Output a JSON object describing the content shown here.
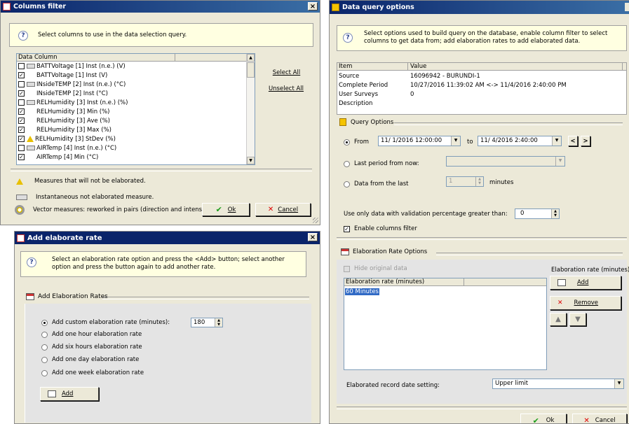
{
  "columns_filter": {
    "title": "Columns filter",
    "close": "×",
    "info": "Select columns to use in the data selection query.",
    "list_header": "Data Column",
    "rows": [
      {
        "checked": false,
        "icon": "instant",
        "text": "BATTVoltage [1] Inst (n.e.) (V)"
      },
      {
        "checked": true,
        "icon": "",
        "text": "BATTVoltage [1] Inst (V)"
      },
      {
        "checked": false,
        "icon": "instant",
        "text": "INsideTEMP [2] Inst (n.e.) (°C)"
      },
      {
        "checked": true,
        "icon": "",
        "text": "INsideTEMP [2] Inst (°C)"
      },
      {
        "checked": false,
        "icon": "instant",
        "text": "RELHumidity [3] Inst (n.e.) (%)"
      },
      {
        "checked": true,
        "icon": "",
        "text": "RELHumidity [3] Min (%)"
      },
      {
        "checked": true,
        "icon": "",
        "text": "RELHumidity [3] Ave (%)"
      },
      {
        "checked": true,
        "icon": "",
        "text": "RELHumidity [3] Max (%)"
      },
      {
        "checked": true,
        "icon": "warning",
        "text": "RELHumidity [3] StDev (%)"
      },
      {
        "checked": false,
        "icon": "instant",
        "text": "AIRTemp [4] Inst (n.e.) (°C)"
      },
      {
        "checked": true,
        "icon": "",
        "text": "AIRTemp [4] Min (°C)"
      }
    ],
    "select_all": "Select All",
    "unselect_all": "Unselect All",
    "legend": {
      "not_elaborated": "Measures that will not be elaborated.",
      "instantaneous": "Instantaneous not elaborated measure.",
      "vector": "Vector measures: reworked in pairs (direction and intensity)"
    },
    "ok": "Ok",
    "cancel": "Cancel"
  },
  "add_rate": {
    "title": "Add elaborate rate",
    "close": "×",
    "info": "Select an elaboration rate option and press the <Add> button; select another option and press the button again to add another rate.",
    "group": "Add Elaboration Rates",
    "options": [
      "Add custom elaboration rate (minutes):",
      "Add one hour elaboration rate",
      "Add six hours elaboration rate",
      "Add one day elaboration rate",
      "Add one week elaboration rate"
    ],
    "custom_value": "180",
    "add": "Add"
  },
  "query": {
    "title": "Data query options",
    "info": "Select options used to build query on the database, enable column filter to select columns to get data from; add elaboration rates to add elaborated data.",
    "props_headers": [
      "Item",
      "Value"
    ],
    "props": [
      [
        "Source",
        "16096942 - BURUNDI-1"
      ],
      [
        "Complete Period",
        "10/27/2016 11:39:02 AM <-> 11/4/2016 2:40:00 PM"
      ],
      [
        "User Surveys",
        "0"
      ],
      [
        "Description",
        ""
      ]
    ],
    "query_group": "Query Options",
    "from_label": "From",
    "from_value": "11/ 1/2016 12:00:00",
    "to_label": "to",
    "to_value": "11/ 4/2016  2:40:00",
    "last_period": "Last period from now:",
    "data_from_last": "Data from the last",
    "last_value": "1",
    "minutes": "minutes",
    "validation": "Use only data with validation percentage greater than:",
    "validation_value": "0",
    "enable_filter": "Enable columns filter",
    "rate_group": "Elaboration Rate Options",
    "hide_original": "Hide original data",
    "rate_minutes_label": "Elaboration rate (minutes):",
    "rate_list_header": "Elaboration rate (minutes)",
    "rate_items": [
      "60 Minutes"
    ],
    "add": "Add",
    "remove": "Remove",
    "record_date_label": "Elaborated record date setting:",
    "record_date_value": "Upper limit",
    "ok": "Ok",
    "cancel": "Cancel"
  },
  "colors": {
    "title_blue": "#0a246a",
    "info_yellow": "#ffffe1",
    "window": "#ece9d8",
    "selection": "#316ac5"
  }
}
